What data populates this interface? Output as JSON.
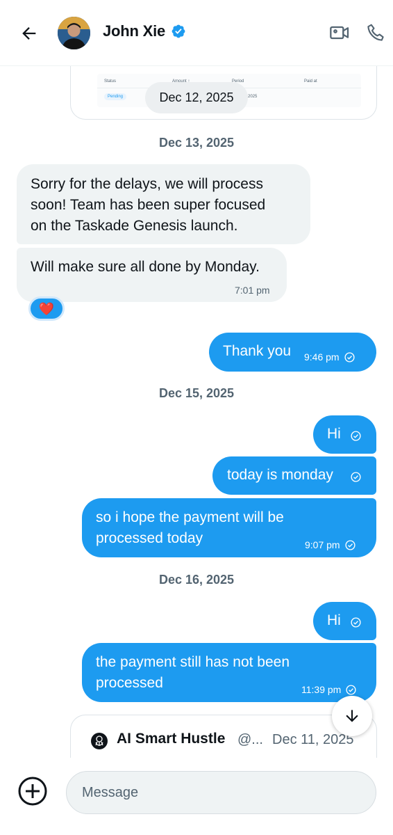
{
  "header": {
    "contact_name": "John Xie",
    "verified": true,
    "icons": [
      "back-arrow-icon",
      "verified-badge-icon",
      "video-call-icon",
      "phone-icon"
    ]
  },
  "embedded_card": {
    "columns": [
      "Status",
      "Amount ↑",
      "Period",
      "Paid at"
    ],
    "status": "Pending",
    "period_fragment": "2025",
    "date_pill": "Dec 12, 2025"
  },
  "date_separators": [
    "Dec 13, 2025",
    "Dec 15, 2025",
    "Dec 16, 2025"
  ],
  "messages": [
    {
      "dir": "in",
      "lines": [
        "Sorry for the delays, we will process",
        "soon! Team has been super focused",
        "on the Taskade Genesis launch."
      ],
      "time": ""
    },
    {
      "dir": "in",
      "lines": [
        "Will make sure all done by Monday."
      ],
      "time": "7:01 pm"
    },
    {
      "dir": "out",
      "lines": [
        "Thank you"
      ],
      "time": "9:46 pm"
    },
    {
      "dir": "out",
      "lines": [
        "Hi"
      ],
      "time": ""
    },
    {
      "dir": "out",
      "lines": [
        "today is monday"
      ],
      "time": ""
    },
    {
      "dir": "out",
      "lines": [
        "so i hope the payment will be",
        "processed today"
      ],
      "time": "9:07 pm"
    },
    {
      "dir": "out",
      "lines": [
        "Hi"
      ],
      "time": ""
    },
    {
      "dir": "out",
      "lines": [
        "the payment still has not been",
        "processed"
      ],
      "time": "11:39 pm"
    }
  ],
  "reaction": "❤️",
  "quoted_post": {
    "name": "AI Smart Hustle",
    "handle": "@...",
    "date": "Dec 11, 2025"
  },
  "composer": {
    "placeholder": "Message"
  },
  "colors": {
    "accent": "#1d9bf0",
    "incoming_bubble": "#eff3f4",
    "secondary_text": "#536471"
  }
}
